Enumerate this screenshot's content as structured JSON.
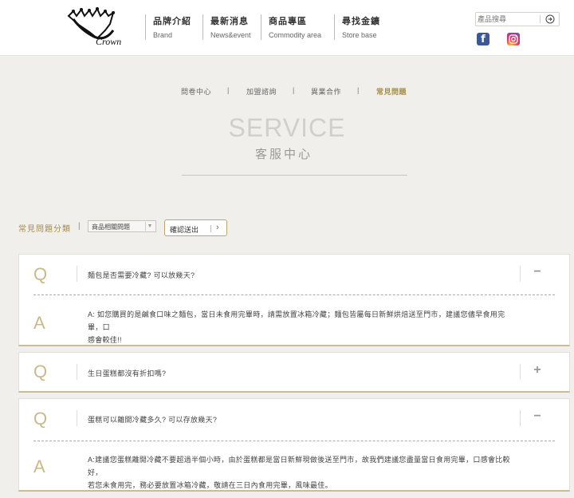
{
  "header": {
    "logo_text": "Crown",
    "nav": [
      {
        "zh": "品牌介紹",
        "en": "Brand"
      },
      {
        "zh": "最新消息",
        "en": "News&event"
      },
      {
        "zh": "商品專區",
        "en": "Commodity area"
      },
      {
        "zh": "尋找金鑛",
        "en": "Store base"
      }
    ],
    "search_placeholder": "產品搜尋",
    "social": {
      "facebook": "f",
      "instagram_icon": "instagram-icon"
    }
  },
  "subnav": {
    "items": [
      "問卷中心",
      "加盟諮詢",
      "異業合作",
      "常見問題"
    ],
    "separator": "|",
    "active_index": 3
  },
  "page": {
    "title_en": "SERVICE",
    "title_zh": "客服中心"
  },
  "filter": {
    "label": "常見問題分類",
    "separator": "|",
    "selected": "商品相關問題",
    "submit_label": "確認送出"
  },
  "faqs": [
    {
      "q_letter": "Q",
      "question": "麵包是否需要冷藏? 可以放幾天?",
      "toggle": "−",
      "expanded": true,
      "a_letter": "A",
      "answer_lines": [
        "A: 如您購買的是鹹食口味之麵包，當日未食用完畢時，請需放置冰箱冷藏；麵包皆屬每日新鮮烘焙送至門市，建議您儘早食用完畢，口",
        "感會較佳!!"
      ]
    },
    {
      "q_letter": "Q",
      "question": "生日蛋糕都沒有折扣嗎?",
      "toggle": "+",
      "expanded": false
    },
    {
      "q_letter": "Q",
      "question": "蛋糕可以離開冷藏多久? 可以存放幾天?",
      "toggle": "−",
      "expanded": true,
      "a_letter": "A",
      "answer_lines": [
        "A:建議您蛋糕離開冷藏不要超過半個小時，由於蛋糕都是當日新鮮現做後送至門市，故我們建議您盡量當日食用完畢，口感會比較好，",
        "若您未食用完，務必要放置冰箱冷藏，敬請在三日內食用完畢，風味最佳。"
      ]
    }
  ],
  "colors": {
    "accent": "#a38f4b",
    "background": "#f1efec",
    "q_letter": "#c9b98a"
  }
}
